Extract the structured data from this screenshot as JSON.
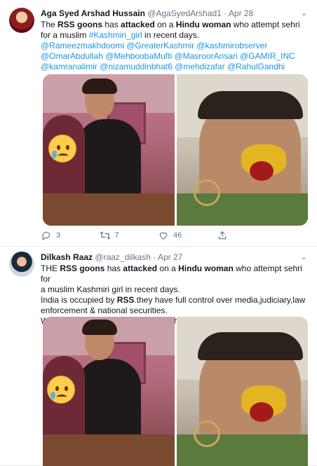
{
  "tweets": [
    {
      "name": "Aga Syed Arshad Hussain",
      "handle": "@AgaSyedArshad1",
      "separator": "·",
      "time": "Apr 28",
      "lines": [
        [
          "The ",
          "RSS goons",
          " has ",
          "attacked",
          " on a ",
          "Hindu woman",
          " who attempt sehri"
        ],
        [
          "for a muslim ",
          "#Kashmiri_girl",
          " in recent days."
        ],
        [
          "@Rameezmakhdoomi @GreaterKashmir @kashmirobserver"
        ],
        [
          "@OmarAbdullah @MehboobaMufti @MasroorAnsari @GAMIR_INC"
        ],
        [
          "@kamranalimir @nizamuddinbhat6 @mehdizafar @RahulGandhi"
        ]
      ],
      "actions": {
        "reply_count": "3",
        "retweet_count": "7",
        "like_count": "46"
      }
    },
    {
      "name": "Dilkash Raaz",
      "handle": "@raaz_dilkash",
      "separator": "·",
      "time": "Apr 27",
      "lines": [
        [
          "THE ",
          "RSS goons",
          " has ",
          "attacked",
          " on a ",
          "Hindu woman",
          " who attempt sehri for"
        ],
        [
          "a muslim Kashmiri girl in recent days."
        ],
        [
          "India is occupied by ",
          "RSS",
          ".they have full control over media,judiciary,law"
        ],
        [
          "enforcement & national securities."
        ],
        [
          "Would this country remain stable if this remains carried on.!!!!"
        ]
      ]
    }
  ],
  "colors": {
    "link": "#1b95e0",
    "muted": "#657786",
    "text": "#14171a",
    "emoji": "#ffcc4d"
  },
  "icons": [
    "caret-down-icon",
    "reply-icon",
    "retweet-icon",
    "like-icon",
    "share-icon",
    "crying-emoji-icon"
  ]
}
